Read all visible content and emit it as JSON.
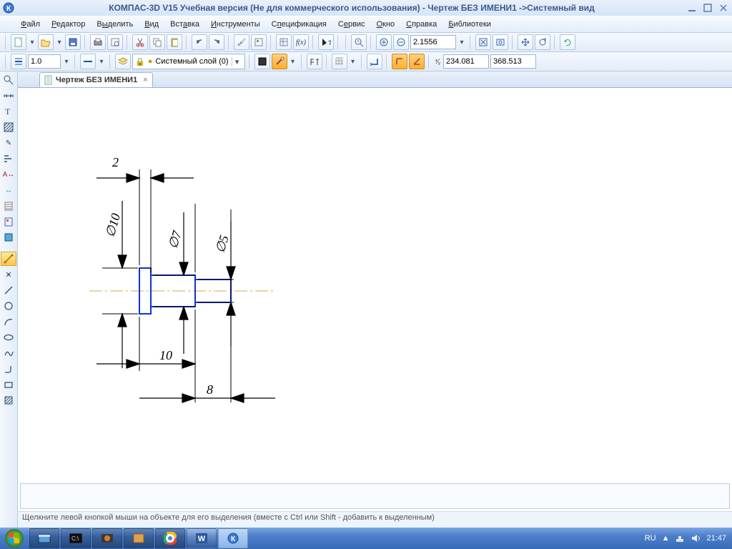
{
  "title": "КОМПАС-3D V15 Учебная версия (Не для коммерческого использования) - Чертеж БЕЗ ИМЕНИ1 ->Системный вид",
  "menu": {
    "file": "Файл",
    "edit": "Редактор",
    "select": "Выделить",
    "view": "Вид",
    "insert": "Вставка",
    "tools": "Инструменты",
    "spec": "Спецификация",
    "service": "Сервис",
    "window": "Окно",
    "help": "Справка",
    "libs": "Библиотеки"
  },
  "row2": {
    "zoom": "2.1556"
  },
  "row3": {
    "linewidth": "1.0",
    "layer": "Системный слой (0)",
    "coord_x": "234.081",
    "coord_y": "368.513"
  },
  "tab": {
    "title": "Чертеж БЕЗ ИМЕНИ1"
  },
  "drawing": {
    "dim_2": "2",
    "dim_d10": "∅10",
    "dim_d7": "∅7",
    "dim_d5": "∅5",
    "dim_10": "10",
    "dim_8": "8"
  },
  "hint": "Щелкните левой кнопкой мыши на объекте для его выделения (вместе с Ctrl или Shift - добавить к выделенным)",
  "taskbar": {
    "lang": "RU",
    "clock": "21:47"
  }
}
